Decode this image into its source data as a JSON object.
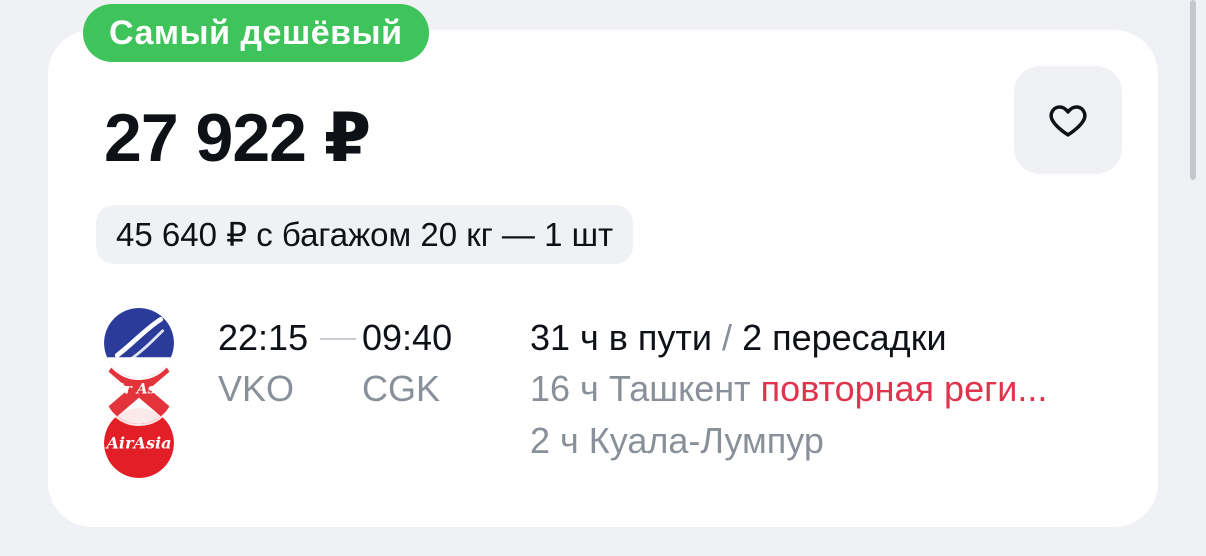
{
  "badge": "Самый дешёвый",
  "price": "27 922 ₽",
  "baggage_offer": "45 640 ₽ с багажом 20 кг — 1 шт",
  "favorite_icon": "heart-outline-icon",
  "airlines": [
    {
      "name": "Uzbekistan Airways",
      "color": "#2a3b9a"
    },
    {
      "name": "AirAsia",
      "color": "#e21f26"
    },
    {
      "name": "AirAsia",
      "color": "#e21f26"
    }
  ],
  "flight": {
    "departure_time": "22:15",
    "arrival_time": "09:40",
    "departure_code": "VKO",
    "arrival_code": "CGK",
    "duration": "31 ч в пути",
    "slash": "/",
    "transfers": "2 пересадки",
    "stops": [
      {
        "duration": "16 ч",
        "city": "Ташкент",
        "warning": "повторная реги..."
      },
      {
        "duration": "2 ч",
        "city": "Куала-Лумпур",
        "warning": ""
      }
    ]
  },
  "colors": {
    "badge": "#3ec45a",
    "warning": "#e0334c",
    "muted": "#8a9099",
    "text": "#0e1217"
  }
}
